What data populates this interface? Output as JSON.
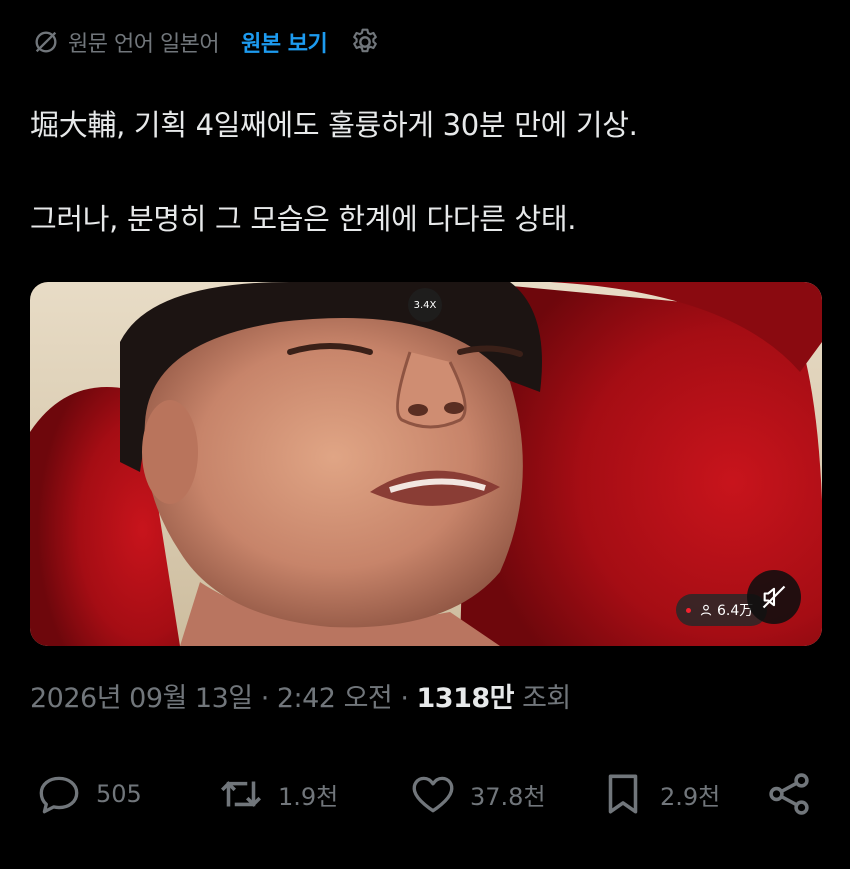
{
  "translation": {
    "source_language_label": "원문 언어 일본어",
    "show_original_label": "원본 보기",
    "globe_icon": "translate-globe-icon",
    "gear_icon": "gear-icon"
  },
  "tweet": {
    "lines": [
      "堀大輔, 기획 4일째에도 훌륭하게 30분 만에 기상.",
      "그러나, 분명히 그 모습은 한계에 다다른 상태."
    ]
  },
  "media": {
    "zoom_label": "3.4X",
    "viewer_count": "6.4万",
    "live_dot_color": "#f4212e",
    "mute_icon": "muted-speaker-icon"
  },
  "meta": {
    "datetime": "2026년 09월 13일 · 2:42 오전 · ",
    "views_count": "1318만",
    "views_suffix": " 조회"
  },
  "actions": {
    "reply_count": "505",
    "repost_count": "1.9천",
    "like_count": "37.8천",
    "bookmark_count": "2.9천"
  },
  "colors": {
    "background": "#000000",
    "text": "#e7e9ea",
    "muted": "#71767b",
    "accent": "#1d9bf0"
  }
}
